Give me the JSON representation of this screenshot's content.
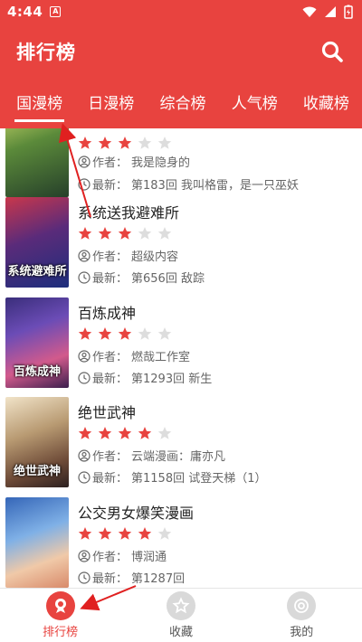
{
  "status_bar": {
    "time": "4:44",
    "notif_glyph": "A"
  },
  "app_bar": {
    "title": "排行榜"
  },
  "tabs": [
    {
      "label": "国漫榜",
      "active": true
    },
    {
      "label": "日漫榜",
      "active": false
    },
    {
      "label": "综合榜",
      "active": false
    },
    {
      "label": "人气榜",
      "active": false
    },
    {
      "label": "收藏榜",
      "active": false
    }
  ],
  "items": [
    {
      "name": "",
      "rating": 3,
      "author_label": "作者：",
      "author": "我是隐身的",
      "latest_label": "最新：",
      "latest": "第183回 我叫格雷，是一只巫妖",
      "cover_text": "",
      "cover_colors": [
        "#c9d66a",
        "#26402a"
      ]
    },
    {
      "name": "系统送我避难所",
      "rating": 3,
      "author_label": "作者：",
      "author": "超级内容",
      "latest_label": "最新：",
      "latest": "第656回 敌踪",
      "cover_text": "系统避难所",
      "cover_colors": [
        "#c9374b",
        "#1d2e7c"
      ]
    },
    {
      "name": "百炼成神",
      "rating": 3,
      "author_label": "作者：",
      "author": "燃哉工作室",
      "latest_label": "最新：",
      "latest": "第1293回 新生",
      "cover_text": "百炼成神",
      "cover_colors": [
        "#3a2e7b",
        "#3c1f4e"
      ]
    },
    {
      "name": "绝世武神",
      "rating": 4,
      "author_label": "作者：",
      "author": "云端漫画：庸亦凡",
      "latest_label": "最新：",
      "latest": "第1158回 试登天梯（1）",
      "cover_text": "绝世武神",
      "cover_colors": [
        "#f1e3c8",
        "#2c2020"
      ]
    },
    {
      "name": "公交男女爆笑漫画",
      "rating": 4,
      "author_label": "作者：",
      "author": "博润通",
      "latest_label": "最新：",
      "latest": "第1287回",
      "cover_text": "",
      "cover_colors": [
        "#3566b8",
        "#d88a6a"
      ]
    }
  ],
  "bottom_nav": [
    {
      "label": "排行榜",
      "icon": "ranking-icon",
      "active": true
    },
    {
      "label": "收藏",
      "icon": "star-icon",
      "active": false
    },
    {
      "label": "我的",
      "icon": "profile-icon",
      "active": false
    }
  ],
  "colors": {
    "accent": "#e8433f",
    "star_on": "#e8433f",
    "star_off": "#dddddd",
    "arrow": "#e02020"
  }
}
